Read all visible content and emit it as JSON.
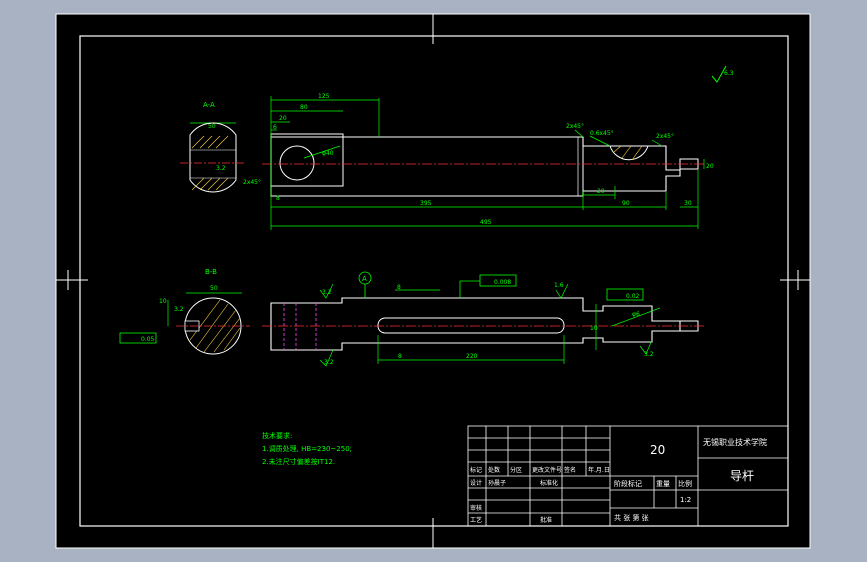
{
  "colors": {
    "background": "#a9b2c3",
    "paper": "#000000",
    "outline": "#ffffff",
    "dimension": "#00ff00",
    "centerline": "#ff3030",
    "hatch": "#ffd23c",
    "hidden": "#ff44ff"
  },
  "section_a": {
    "label": "A-A",
    "width_dim": "50",
    "roughness": "3.2",
    "chamfer": "2x45°"
  },
  "section_b": {
    "label": "B-B",
    "width_dim": "50",
    "roughness": "3.2",
    "tolerance": "0.05",
    "depth": "10"
  },
  "top_view": {
    "dims": {
      "d1": "125",
      "d2": "80",
      "d3": "20",
      "d4": "6",
      "d5": "395",
      "d6": "495",
      "d7": "90",
      "d8": "30",
      "d9": "20",
      "d10": "8",
      "d11": "20"
    },
    "callouts": {
      "chamfer_left": "2x45°",
      "chamfer_mid": "2x45°",
      "chamfer_right": "2x45°",
      "bevel": "0.6x45°",
      "hole": "φ40"
    },
    "corner_roughness": "6.3"
  },
  "front_view": {
    "datum": "A",
    "dims": {
      "slot": "8",
      "slot_len": "220",
      "depth": "8",
      "dia": "φ6",
      "slot_width": "10"
    },
    "roughness": {
      "r1": "3.2",
      "r2": "1.6",
      "r3": "3.2",
      "r4": "3.2"
    },
    "tolerances": {
      "flatness": "0.008",
      "runout": "0.02"
    }
  },
  "tech_notes": {
    "title": "技术要求:",
    "lines": [
      "1.调质处理, HB=230~250;",
      "2.未注尺寸偏差按IT12."
    ]
  },
  "title_block": {
    "material": "20",
    "school": "无锡职业技术学院",
    "part_name": "导杆",
    "scale_label": "比例",
    "scale": "1:2",
    "weight_label": "重量",
    "stage_label": "阶段标记",
    "sheet_label": "共    张  第    张",
    "row1": [
      "标记",
      "处数",
      "分区",
      "更改文件号",
      "签名",
      "年.月.日"
    ],
    "design_label": "设计",
    "designer": "孙晨子",
    "standard_label": "标准化",
    "review_label": "审核",
    "craft_label": "工艺",
    "approve_label": "批准"
  }
}
